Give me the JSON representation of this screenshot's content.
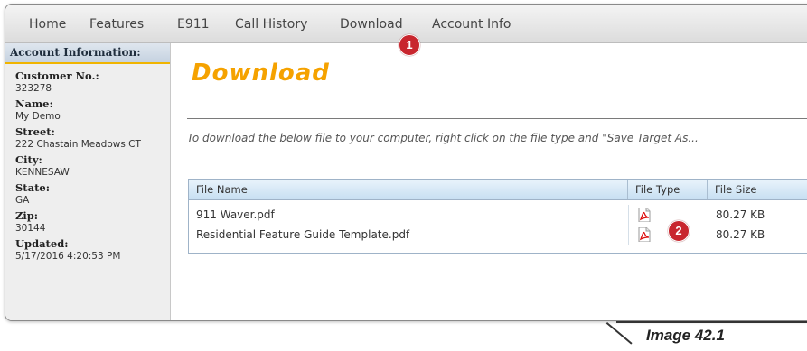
{
  "nav": {
    "items": [
      "Home",
      "Features",
      "E911",
      "Call History",
      "Download",
      "Account Info"
    ]
  },
  "sidebar": {
    "header": "Account Information:",
    "fields": [
      {
        "label": "Customer No.:",
        "value": "323278"
      },
      {
        "label": "Name:",
        "value": "My Demo"
      },
      {
        "label": "Street:",
        "value": "222 Chastain Meadows CT"
      },
      {
        "label": "City:",
        "value": "KENNESAW"
      },
      {
        "label": "State:",
        "value": "GA"
      },
      {
        "label": "Zip:",
        "value": "30144"
      },
      {
        "label": "Updated:",
        "value": "5/17/2016 4:20:53 PM"
      }
    ]
  },
  "main": {
    "title": "Download",
    "instructions": "To download the below file to your computer, right click on the file type and \"Save Target As...",
    "table": {
      "headers": [
        "File Name",
        "File Type",
        "File Size"
      ],
      "rows": [
        {
          "name": "911 Waver.pdf",
          "type_icon": "pdf-icon",
          "size": "80.27 KB"
        },
        {
          "name": "Residential Feature Guide Template.pdf",
          "type_icon": "pdf-icon",
          "size": "80.27 KB"
        }
      ]
    }
  },
  "callouts": [
    "1",
    "2"
  ],
  "caption": "Image 42.1",
  "colors": {
    "title": "#f5a200",
    "badge": "#c8262e",
    "sidebar_accent": "#f0b400"
  }
}
